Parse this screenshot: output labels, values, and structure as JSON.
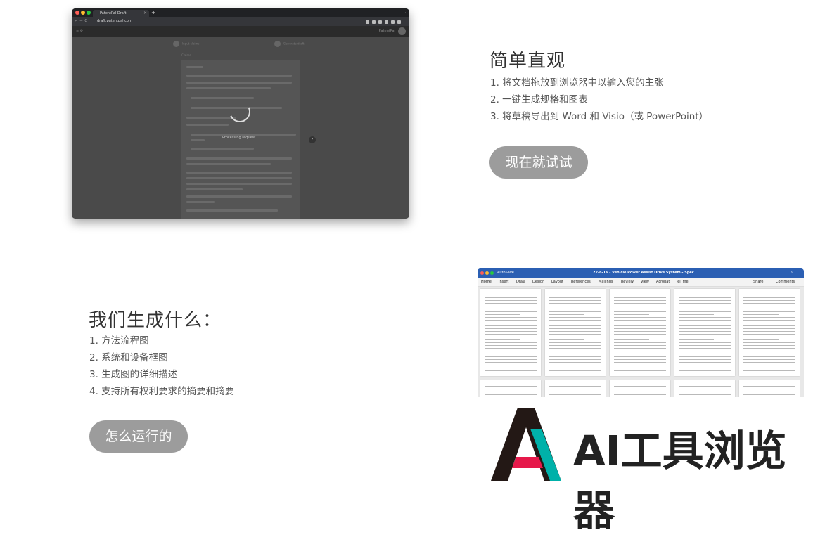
{
  "browser_shot": {
    "tab_title": "PatentPal Draft",
    "url": "draft.patentpal.com",
    "brand": "PatentPal",
    "step1": "Input claims",
    "step2": "Generate draft",
    "claims_label": "Claims",
    "processing": "Processing request..."
  },
  "section1": {
    "title": "简单直观",
    "items": [
      "1. 将文档拖放到浏览器中以输入您的主张",
      "2. 一键生成规格和图表",
      "3. 将草稿导出到 Word 和 Visio（或 PowerPoint）"
    ],
    "button": "现在就试试"
  },
  "section2": {
    "title": "我们生成什么：",
    "items": [
      "1. 方法流程图",
      "2. 系统和设备框图",
      "3. 生成图的详细描述",
      "4. 支持所有权利要求的摘要和摘要"
    ],
    "button": "怎么运行的"
  },
  "word_shot": {
    "autosave": "AutoSave",
    "doc_title": "22-8-16 - Vehicle Power Assist Drive System - Spec",
    "tabs": [
      "Home",
      "Insert",
      "Draw",
      "Design",
      "Layout",
      "References",
      "Mailings",
      "Review",
      "View",
      "Acrobat",
      "Tell me"
    ],
    "share": "Share",
    "comments": "Comments"
  },
  "logo": {
    "text": "AI工具浏览器",
    "colors": {
      "black": "#231815",
      "teal": "#00b1a9",
      "red": "#e6184a"
    }
  }
}
